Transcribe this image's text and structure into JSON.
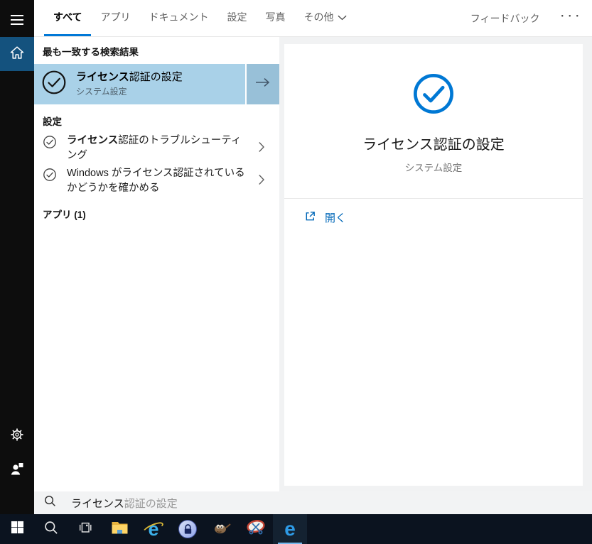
{
  "header": {
    "tabs": [
      {
        "label": "すべて",
        "active": true
      },
      {
        "label": "アプリ",
        "active": false
      },
      {
        "label": "ドキュメント",
        "active": false
      },
      {
        "label": "設定",
        "active": false
      },
      {
        "label": "写真",
        "active": false
      },
      {
        "label": "その他",
        "active": false
      }
    ],
    "feedback_label": "フィードバック",
    "more_label": "･･･"
  },
  "left_panel": {
    "best_match_header": "最も一致する検索結果",
    "best_match": {
      "title_bold": "ライセンス",
      "title_rest": "認証の設定",
      "subtitle": "システム設定"
    },
    "settings_header": "設定",
    "settings_items": [
      {
        "bold": "ライセンス",
        "rest": "認証のトラブルシューティング"
      },
      {
        "bold": "",
        "rest": "Windows がライセンス認証されているかどうかを確かめる"
      }
    ],
    "apps_header": "アプリ (1)"
  },
  "preview": {
    "title": "ライセンス認証の設定",
    "subtitle": "システム設定",
    "open_label": "開く"
  },
  "search_bar": {
    "typed": "ライセンス",
    "suggestion": "認証の設定"
  },
  "colors": {
    "accent_blue": "#0078d4",
    "highlight_bg": "#a9d1e8",
    "highlight_arrow_bg": "#98c0d8",
    "sidebar_home_bg": "#14527e",
    "taskbar_bg": "#0b131f",
    "link_blue": "#0067b8",
    "edge_underline": "#76b9ed"
  }
}
